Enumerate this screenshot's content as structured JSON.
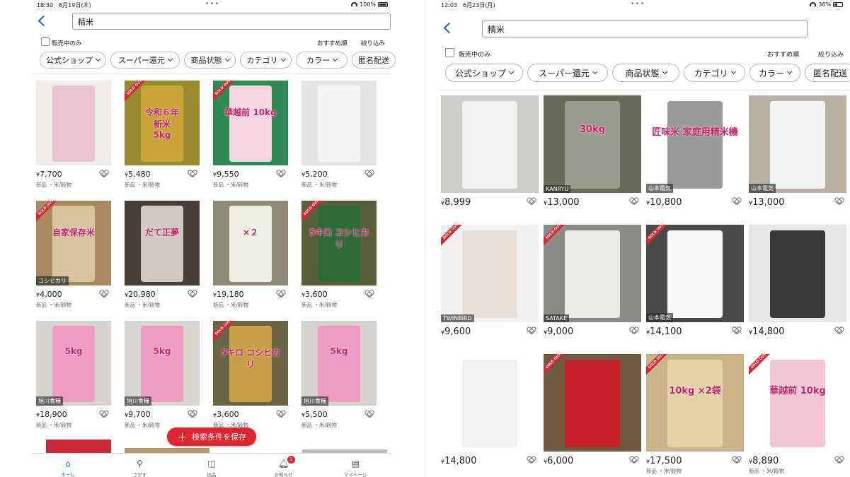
{
  "left": {
    "status": {
      "time_date": "18:30　6月19日(木)",
      "battery": "100%"
    },
    "search_value": "精米",
    "on_sale_label": "販売中のみ",
    "sort_label": "おすすめ順",
    "filter_label": "絞り込み",
    "filters": [
      "公式ショップ",
      "スーパー還元",
      "商品状態",
      "カテゴリ",
      "カラー",
      "匿名配送"
    ],
    "items": [
      {
        "price": "7,700",
        "cond": "新品 ・米/穀物",
        "sold": false,
        "brand": "",
        "overlay": "",
        "bg": "#f0ede8",
        "fg": "#e8c6d4"
      },
      {
        "price": "5,480",
        "cond": "新品 ・米/穀物",
        "sold": true,
        "brand": "",
        "overlay": "令和６年\n新米\n5kg",
        "bg": "#9a8a2e",
        "fg": "#c9a43a"
      },
      {
        "price": "9,550",
        "cond": "新品 ・米/穀物",
        "sold": true,
        "brand": "",
        "overlay": "華越前 10kg",
        "bg": "#2f8a55",
        "fg": "#f3d4e0"
      },
      {
        "price": "5,200",
        "cond": "新品 ・米/穀物",
        "sold": false,
        "brand": "",
        "overlay": "",
        "bg": "#e4e4e2",
        "fg": "#f4f4f4"
      },
      {
        "price": "4,000",
        "cond": "新品 ・米/穀物",
        "sold": true,
        "brand": "コシヒカリ",
        "overlay": "自家保存米",
        "bg": "#a78a5d",
        "fg": "#d8c49b"
      },
      {
        "price": "20,980",
        "cond": "新品 ・米/穀物",
        "sold": false,
        "brand": "",
        "overlay": "だて正夢",
        "bg": "#4a3e3a",
        "fg": "#cfc8c0"
      },
      {
        "price": "19,180",
        "cond": "新品 ・米/穀物",
        "sold": false,
        "brand": "",
        "overlay": "×２",
        "bg": "#8d8a78",
        "fg": "#f0efe4"
      },
      {
        "price": "3,600",
        "cond": "新品 ・米/穀物",
        "sold": true,
        "brand": "",
        "overlay": "5キロ コシヒカリ",
        "bg": "#5b5e3a",
        "fg": "#2f6b3a"
      },
      {
        "price": "18,900",
        "cond": "新品 ・米/穀物",
        "sold": false,
        "brand": "旭川食糧",
        "overlay": "5kg",
        "bg": "#d6d3cf",
        "fg": "#ee9cc4"
      },
      {
        "price": "9,700",
        "cond": "新品 ・米/穀物",
        "sold": false,
        "brand": "旭川食糧",
        "overlay": "5kg",
        "bg": "#d9d6d2",
        "fg": "#ee9cc4"
      },
      {
        "price": "3,600",
        "cond": "新品 ・米/穀物",
        "sold": true,
        "brand": "",
        "overlay": "5キロ コシヒカリ",
        "bg": "#6b6545",
        "fg": "#c9a04a"
      },
      {
        "price": "5,500",
        "cond": "新品 ・米/穀物",
        "sold": false,
        "brand": "旭川食糧",
        "overlay": "5kg",
        "bg": "#d5d2ce",
        "fg": "#ee9cc4"
      }
    ],
    "save_button": "検索条件を保存",
    "tabs": [
      {
        "label": "ホーム",
        "icon": "home-icon"
      },
      {
        "label": "さがす",
        "icon": "search-icon"
      },
      {
        "label": "出品",
        "icon": "camera-icon"
      },
      {
        "label": "お知らせ",
        "icon": "bell-icon",
        "badge": "1"
      },
      {
        "label": "マイページ",
        "icon": "profile-icon"
      }
    ]
  },
  "right": {
    "status": {
      "time_date": "12:03　6月23日(月)",
      "battery": "36%"
    },
    "search_value": "精米",
    "on_sale_label": "販売中のみ",
    "sort_label": "おすすめ順",
    "filter_label": "絞り込み",
    "filters": [
      "公式ショップ",
      "スーパー還元",
      "商品状態",
      "カテゴリ",
      "カラー",
      "匿名配送"
    ],
    "items": [
      {
        "price": "8,999",
        "sold": false,
        "brand": "",
        "overlay": "",
        "bg": "#cfcdca",
        "fg": "#f2f2f0"
      },
      {
        "price": "13,000",
        "sold": false,
        "brand": "KANRYU",
        "overlay": "30kg",
        "bg": "#6a6a5a",
        "fg": "#9a9c8e"
      },
      {
        "price": "10,800",
        "sold": false,
        "brand": "山本電気",
        "overlay": "匠味米 家庭用精米機",
        "bg": "#ffffff",
        "fg": "#9a9a98"
      },
      {
        "price": "13,000",
        "sold": false,
        "brand": "山本電気",
        "overlay": "",
        "bg": "#b9b2a4",
        "fg": "#f4f4f4"
      },
      {
        "price": "9,600",
        "sold": true,
        "brand": "TWINBIRD",
        "overlay": "",
        "bg": "#f2f0ee",
        "fg": "#e8e0d8"
      },
      {
        "price": "9,000",
        "sold": true,
        "brand": "SATAKE",
        "overlay": "",
        "bg": "#8a8a86",
        "fg": "#e8eae6"
      },
      {
        "price": "14,100",
        "sold": true,
        "brand": "山本電気",
        "overlay": "",
        "bg": "#4a4a48",
        "fg": "#f6f6f6"
      },
      {
        "price": "14,800",
        "sold": false,
        "brand": "",
        "overlay": "",
        "bg": "#e6e6e4",
        "fg": "#3a3a3a"
      },
      {
        "price": "14,800",
        "sold": false,
        "brand": "",
        "overlay": "",
        "bg": "#ffffff",
        "fg": "#f2f2f2"
      },
      {
        "price": "6,000",
        "sold": true,
        "brand": "",
        "overlay": "",
        "bg": "#6e5a40",
        "fg": "#c8202a"
      },
      {
        "price": "17,500",
        "sold": true,
        "brand": "",
        "overlay": "10kg ×2袋",
        "bg": "#c9b388",
        "fg": "#e6d4a8",
        "cond": "新品 ・米/穀物"
      },
      {
        "price": "8,890",
        "sold": true,
        "brand": "",
        "overlay": "華越前 10kg",
        "bg": "#ffffff",
        "fg": "#f3c6d6",
        "cond": "新品 ・米/穀物"
      }
    ]
  }
}
